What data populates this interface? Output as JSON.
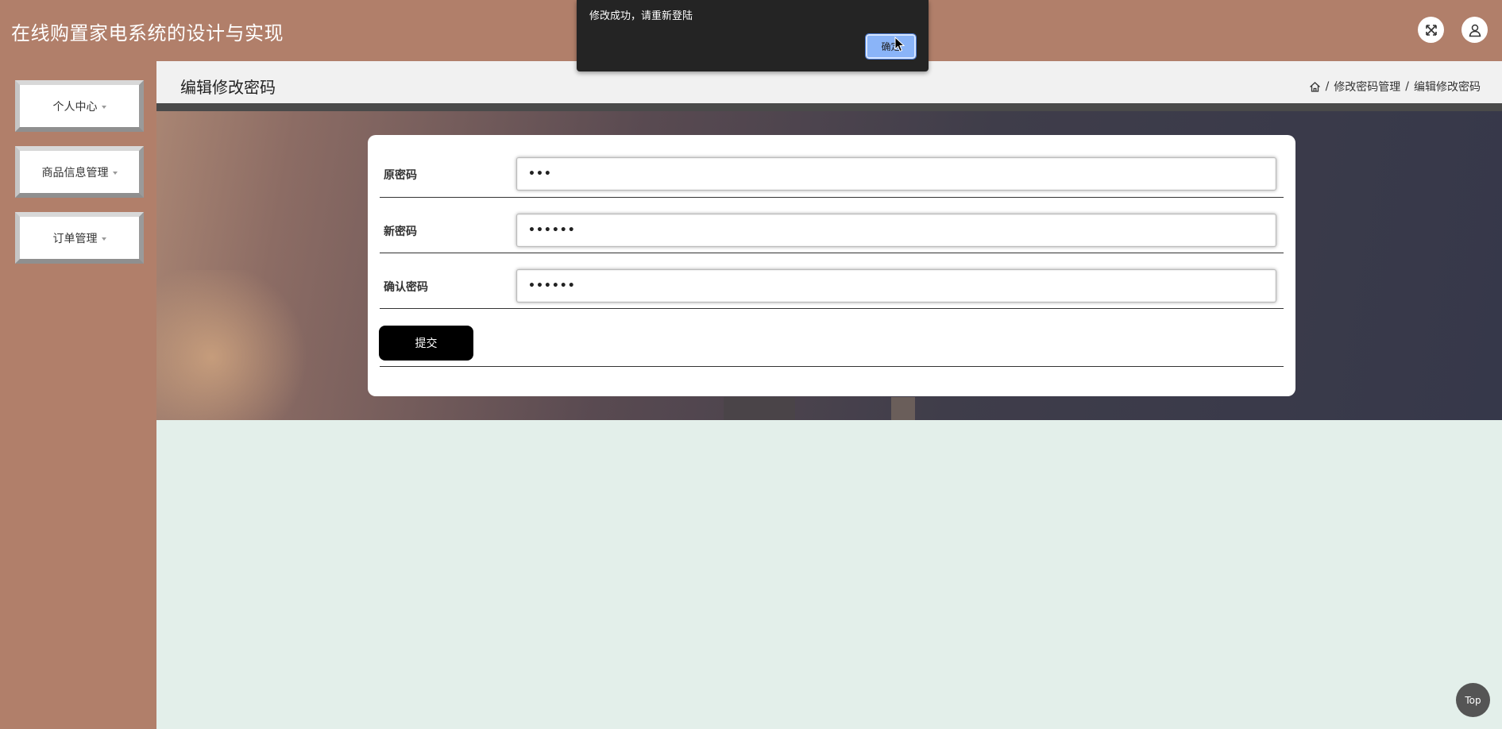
{
  "header": {
    "title": "在线购置家电系统的设计与实现",
    "fullscreen_icon": "fullscreen-icon",
    "user_icon": "user-icon"
  },
  "sidebar": {
    "items": [
      {
        "label": "个人中心"
      },
      {
        "label": "商品信息管理"
      },
      {
        "label": "订单管理"
      }
    ]
  },
  "page": {
    "title": "编辑修改密码",
    "breadcrumb": [
      "修改密码管理",
      "编辑修改密码"
    ],
    "breadcrumb_separator": "/"
  },
  "form": {
    "fields": [
      {
        "label": "原密码",
        "value": "•••"
      },
      {
        "label": "新密码",
        "value": "••••••"
      },
      {
        "label": "确认密码",
        "value": "••••••"
      }
    ],
    "submit_label": "提交"
  },
  "dialog": {
    "message": "修改成功，请重新登陆",
    "ok_label": "确定"
  },
  "back_to_top": {
    "label": "Top"
  },
  "colors": {
    "header_bg": "#b17f6a",
    "content_bg": "#e3efea",
    "submit_bg": "#000000",
    "dialog_bg": "#242424",
    "dialog_button": "#8ab4f8"
  }
}
